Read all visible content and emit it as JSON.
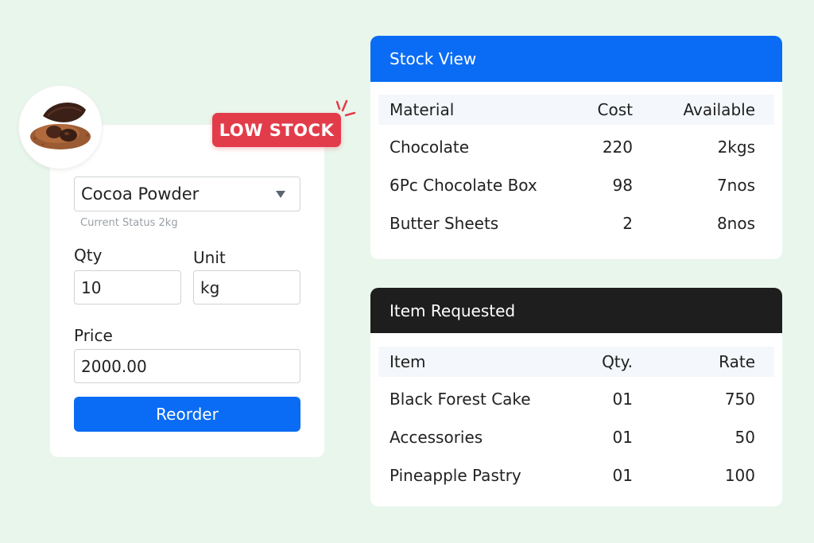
{
  "reorder_form": {
    "product_image": "cocoa-powder-image",
    "badge": "LOW STOCK",
    "material_select": {
      "value": "Cocoa Powder"
    },
    "current_status": "Current Status 2kg",
    "qty": {
      "label": "Qty",
      "value": "10"
    },
    "unit": {
      "label": "Unit",
      "value": "kg"
    },
    "price": {
      "label": "Price",
      "value": "2000.00"
    },
    "reorder_button": "Reorder"
  },
  "stock_view": {
    "title": "Stock View",
    "columns": [
      "Material",
      "Cost",
      "Available"
    ],
    "rows": [
      {
        "material": "Chocolate",
        "cost": "220",
        "available": "2kgs"
      },
      {
        "material": "6Pc Chocolate Box",
        "cost": "98",
        "available": "7nos"
      },
      {
        "material": "Butter Sheets",
        "cost": "2",
        "available": "8nos"
      }
    ]
  },
  "item_requested": {
    "title": "Item Requested",
    "columns": [
      "Item",
      "Qty.",
      "Rate"
    ],
    "rows": [
      {
        "item": "Black Forest Cake",
        "qty": "01",
        "rate": "750"
      },
      {
        "item": "Accessories",
        "qty": "01",
        "rate": "50"
      },
      {
        "item": "Pineapple Pastry",
        "qty": "01",
        "rate": "100"
      }
    ]
  },
  "colors": {
    "background": "#e9f6ec",
    "accent_blue": "#0a6cf5",
    "badge_red": "#e23c4a",
    "dark_header": "#1e1e1e"
  }
}
